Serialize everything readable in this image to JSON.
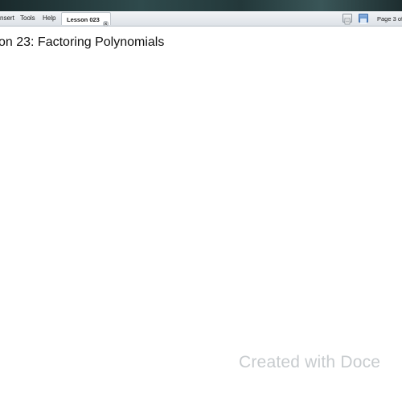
{
  "menu": {
    "items": [
      "nsert",
      "Tools",
      "Help"
    ]
  },
  "tab": {
    "label": "Lesson 023"
  },
  "status": {
    "page_label": "Page 3 of"
  },
  "document": {
    "title": "on 23: Factoring Polynomials"
  },
  "watermark": {
    "text": "Created with Doce"
  },
  "icons": {
    "tab_close": "close-icon",
    "view_normal": "page-view-icon",
    "view_active": "slide-view-icon"
  },
  "colors": {
    "titlebar": "#23383a",
    "active_view": "#4a7fc2",
    "watermark": "#c7cbce"
  }
}
